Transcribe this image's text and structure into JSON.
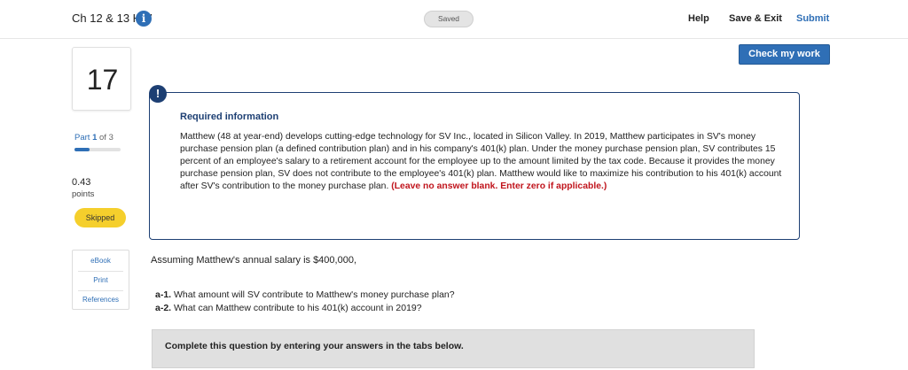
{
  "header": {
    "title": "Ch 12 & 13 HW",
    "saved_label": "Saved",
    "help_label": "Help",
    "save_exit_label": "Save & Exit",
    "submit_label": "Submit",
    "info_icon": "info-icon"
  },
  "actions": {
    "check_my_work_label": "Check my work"
  },
  "question": {
    "number": "17",
    "part_prefix": "Part",
    "part_current": "1",
    "part_of": "of 3",
    "part_progress": 0.333,
    "points_value": "0.43",
    "points_label": "points",
    "status_label": "Skipped"
  },
  "resources": {
    "ebook": "eBook",
    "print": "Print",
    "references": "References"
  },
  "required_info": {
    "icon": "!",
    "title": "Required information",
    "body": "Matthew (48 at year-end) develops cutting-edge technology for SV Inc., located in Silicon Valley. In 2019, Matthew participates in SV's money purchase pension plan (a defined contribution plan) and in his company's 401(k) plan. Under the money purchase pension plan, SV contributes 15 percent of an employee's salary to a retirement account for the employee up to the amount limited by the tax code. Because it provides the money purchase pension plan, SV does not contribute to the employee's 401(k) plan. Matthew would like to maximize his contribution to his 401(k) account after SV's contribution to the money purchase plan.",
    "warning": "(Leave no answer blank. Enter zero if applicable.)"
  },
  "prompt": {
    "assumption": "Assuming Matthew's annual salary is $400,000,",
    "a1_label": "a-1.",
    "a1_text": "What amount will SV contribute to Matthew's money purchase plan?",
    "a2_label": "a-2.",
    "a2_text": "What can Matthew contribute to his 401(k) account in 2019?"
  },
  "instructions": {
    "complete_text": "Complete this question by entering your answers in the tabs below."
  },
  "colors": {
    "accent_blue": "#2f6fb6",
    "navy": "#1d3f73",
    "warning_red": "#c0141c",
    "skipped_yellow": "#f5cf2c"
  }
}
